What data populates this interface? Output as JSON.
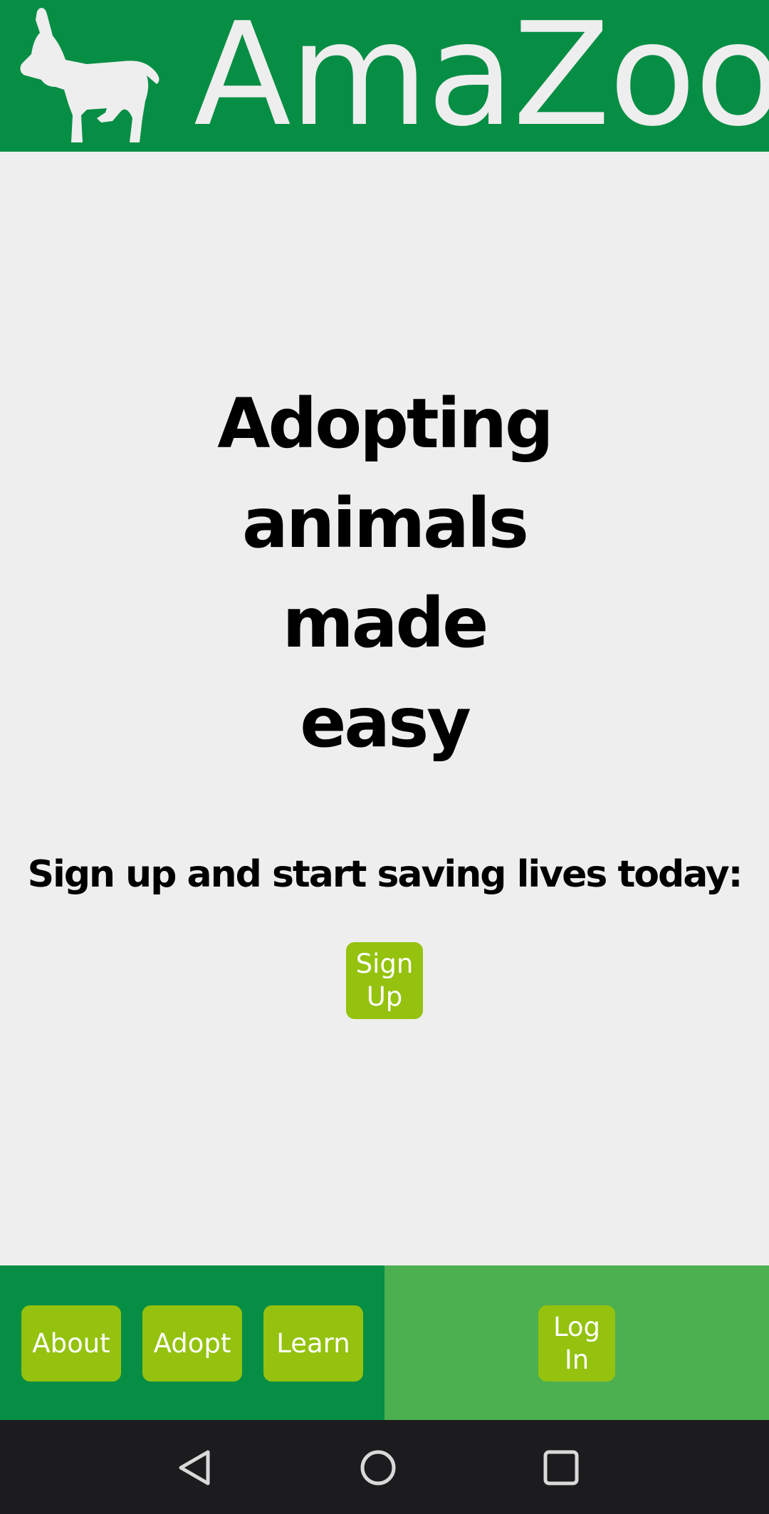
{
  "header": {
    "app_title": "AmaZoo",
    "logo_icon": "donkey-icon",
    "background_color": "#068e44"
  },
  "hero": {
    "headline_lines": [
      "Adopting",
      "animals",
      "made",
      "easy"
    ],
    "subheading": "Sign up and start saving lives today:"
  },
  "signup": {
    "label": "Sign\nUp"
  },
  "bottom_nav": {
    "about_label": "About",
    "adopt_label": "Adopt",
    "learn_label": "Learn",
    "login_label": "Log\nIn"
  },
  "system_nav": {
    "back_icon": "triangle-back-icon",
    "home_icon": "circle-home-icon",
    "recents_icon": "square-recents-icon"
  },
  "colors": {
    "primary": "#068e44",
    "secondary": "#4caf50",
    "button": "#94c20e",
    "background": "#eeeeee",
    "system_bar": "#1c1c1e"
  }
}
